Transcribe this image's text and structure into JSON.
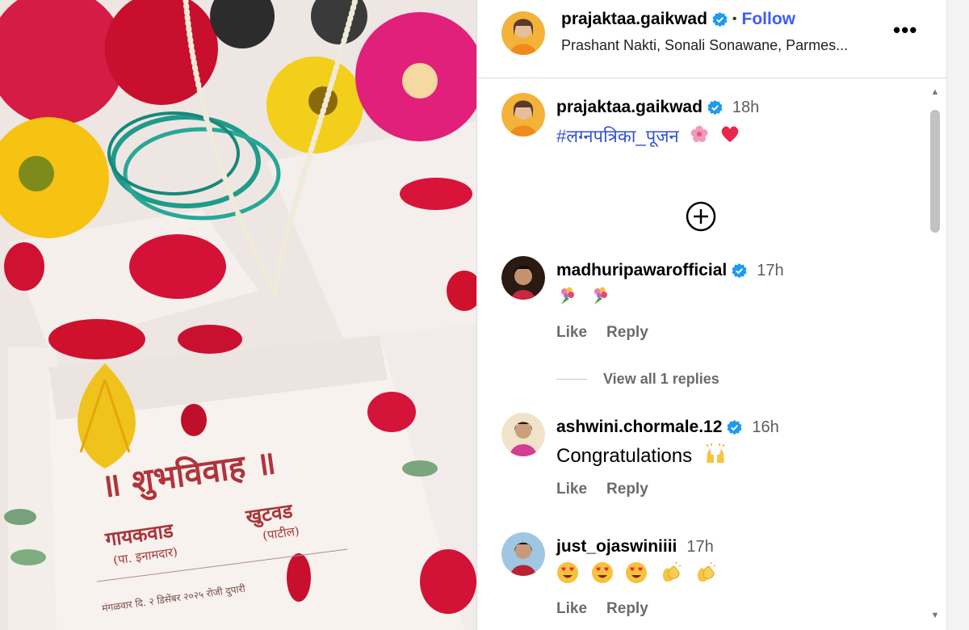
{
  "post_author": {
    "username": "prajaktaa.gaikwad",
    "follow_label": "Follow",
    "separator": "•",
    "collaborators": "Prashant Nakti, Sonali Sonawane, Parmes...",
    "more_label": "•••"
  },
  "photo": {
    "card_heading": "॥ शुभविवाह ॥",
    "left_name": "गायकवाड",
    "left_sub": "(पा. इनामदार)",
    "right_name": "खुटवड",
    "right_sub": "(पाटील)",
    "date_line": "मंगळवार दि. २ डिसेंबर २०२५ रोजी दुपारी"
  },
  "caption": {
    "username": "prajaktaa.gaikwad",
    "time": "18h",
    "hashtag": "#लग्नपत्रिका_पूजन"
  },
  "comments": [
    {
      "username": "madhuripawarofficial",
      "time": "17h",
      "like": "Like",
      "reply": "Reply",
      "view_replies": "View all 1 replies"
    },
    {
      "username": "ashwini.chormale.12",
      "time": "16h",
      "text": "Congratulations",
      "like": "Like",
      "reply": "Reply"
    },
    {
      "username": "just_ojaswiniiii",
      "time": "17h",
      "like": "Like",
      "reply": "Reply"
    }
  ],
  "icons": {
    "verified": "verified-badge-icon",
    "add": "plus-circle-icon",
    "more": "more-options-icon"
  },
  "colors": {
    "link_blue": "#3d5cf5",
    "verified_blue": "#1d9bf0",
    "hashtag_blue": "#3354d1",
    "muted_text": "#6b6b6b"
  }
}
